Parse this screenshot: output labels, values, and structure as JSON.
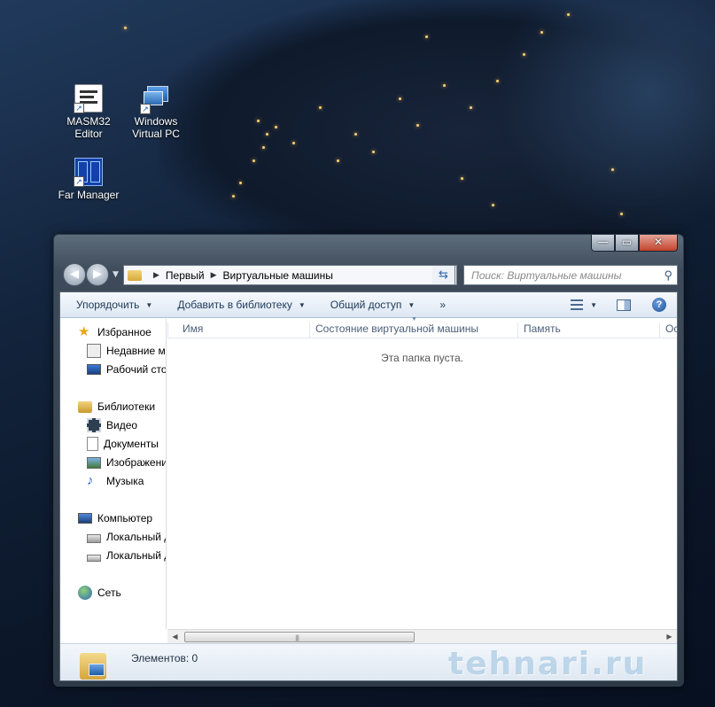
{
  "desktop": {
    "icons": [
      {
        "label": "MASM32\nEditor",
        "icon": "masm32-editor-icon"
      },
      {
        "label": "Windows\nVirtual PC",
        "icon": "virtual-pc-icon"
      },
      {
        "label": "Far Manager",
        "icon": "far-manager-icon"
      }
    ],
    "icon_labels": {
      "masm_line1": "MASM32",
      "masm_line2": "Editor",
      "vpc_line1": "Windows",
      "vpc_line2": "Virtual PC",
      "far": "Far Manager"
    }
  },
  "window": {
    "caption_buttons": {
      "minimize": "—",
      "maximize": "▭",
      "close": "✕"
    },
    "nav": {
      "back": "◀",
      "forward": "▶"
    },
    "address": {
      "separator": "▶",
      "crumbs": [
        "Первый",
        "Виртуальные машины"
      ]
    },
    "search": {
      "placeholder": "Поиск: Виртуальные машины"
    },
    "toolbar": {
      "organize": "Упорядочить",
      "add_to_library": "Добавить в библиотеку",
      "share": "Общий доступ",
      "more": "»"
    },
    "sidebar": {
      "favorites": "Избранное",
      "recent": "Недавние места",
      "desktop": "Рабочий стол",
      "libraries": "Библиотеки",
      "video": "Видео",
      "documents": "Документы",
      "pictures": "Изображения",
      "music": "Музыка",
      "computer": "Компьютер",
      "local_disk_1": "Локальный диск",
      "local_disk_2": "Локальный диск",
      "network": "Сеть"
    },
    "columns": {
      "name": "Имя",
      "vm_state": "Состояние виртуальной машины",
      "memory": "Память",
      "os": "Ос"
    },
    "empty_text": "Эта папка пуста.",
    "status": {
      "items": "Элементов: 0"
    },
    "watermark": "tehnari.ru"
  },
  "colors": {
    "accent": "#1e395b",
    "toolbar_bg": "#dde7f3",
    "close_button": "#c2432d"
  }
}
